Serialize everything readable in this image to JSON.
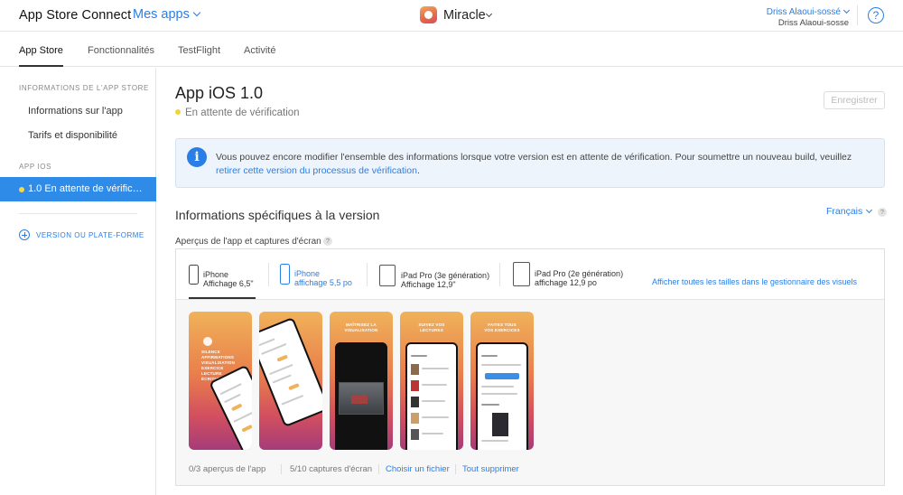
{
  "header": {
    "brand": "App Store Connect",
    "apps_menu": "Mes apps",
    "app_name": "Miracle",
    "user_name": "Driss Alaoui-sossé",
    "user_sub": "Driss Alaoui-sosse",
    "help": "?"
  },
  "tabs": [
    {
      "label": "App Store",
      "active": true
    },
    {
      "label": "Fonctionnalités",
      "active": false
    },
    {
      "label": "TestFlight",
      "active": false
    },
    {
      "label": "Activité",
      "active": false
    }
  ],
  "sidebar": {
    "section1": "INFORMATIONS DE L'APP STORE",
    "items1": [
      "Informations sur l'app",
      "Tarifs et disponibilité"
    ],
    "section2": "APP IOS",
    "active_item": "1.0 En attente de vérific…",
    "add": "VERSION OU PLATE-FORME"
  },
  "main": {
    "title": "App iOS 1.0",
    "status": "En attente de vérification",
    "save": "Enregistrer",
    "info_text": "Vous pouvez encore modifier l'ensemble des informations lorsque votre version est en attente de vérification. Pour soumettre un nouveau build, veuillez ",
    "info_link": "retirer cette version du processus de vérification",
    "info_end": ".",
    "section_title": "Informations spécifiques à la version",
    "language": "Français",
    "previews_label": "Aperçus de l'app et captures d'écran"
  },
  "devices": [
    {
      "name": "iPhone",
      "size": "Affichage 6,5\"",
      "selected": false
    },
    {
      "name": "iPhone",
      "size": "affichage 5,5 po",
      "selected": true
    },
    {
      "name": "iPad Pro (3e génération)",
      "size": "Affichage 12,9\"",
      "selected": false
    },
    {
      "name": "iPad Pro (2e génération)",
      "size": "affichage 12,9 po",
      "selected": false
    }
  ],
  "show_all": "Afficher toutes les tailles dans le gestionnaire des visuels",
  "screenshots": [
    {
      "caption": "SILENCE\nAFFIRMATIONS\nVISUALISATION\nEXERCICE\nLECTURE\nÉCRITURE"
    },
    {
      "caption": ""
    },
    {
      "caption": "MAÎTRISEZ LA\nVISUALISATION"
    },
    {
      "caption": "SUIVEZ VOS\nLECTURES"
    },
    {
      "caption": "FAITES TOUS\nVOS EXERCICES"
    }
  ],
  "footer": {
    "previews_count": "0/3 aperçus de l'app",
    "shots_count": "5/10 captures d'écran",
    "choose": "Choisir un fichier",
    "delete_all": "Tout supprimer"
  },
  "colors": {
    "accent": "#2a7ee6",
    "status_dot": "#f2d33e",
    "sidebar_active": "#2e8be8"
  }
}
